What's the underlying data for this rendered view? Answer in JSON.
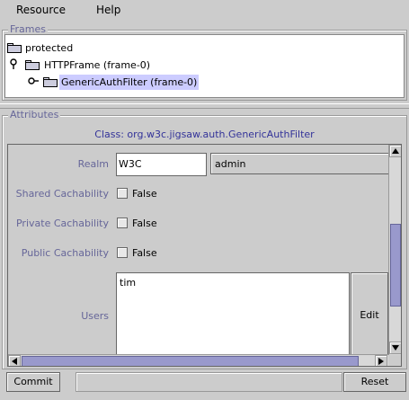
{
  "menubar": {
    "items": [
      "Resource",
      "Help"
    ]
  },
  "frames": {
    "title": "Frames",
    "nodes": [
      {
        "label": "protected"
      },
      {
        "label": "HTTPFrame (frame-0)"
      },
      {
        "label": "GenericAuthFilter (frame-0)"
      }
    ]
  },
  "attributes": {
    "title": "Attributes",
    "class_label": "Class: org.w3c.jigsaw.auth.GenericAuthFilter",
    "realm": {
      "label": "Realm",
      "value": "W3C",
      "select_value": "admin"
    },
    "shared": {
      "label": "Shared Cachability",
      "value": "False"
    },
    "private": {
      "label": "Private Cachability",
      "value": "False"
    },
    "public": {
      "label": "Public Cachability",
      "value": "False"
    },
    "users": {
      "label": "Users",
      "value": "tim",
      "edit_label": "Edit"
    }
  },
  "footer": {
    "commit_label": "Commit",
    "reset_label": "Reset"
  },
  "colors": {
    "accent": "#333399",
    "label": "#666699",
    "selection": "#ccccff",
    "scroll_thumb": "#9999cc"
  }
}
